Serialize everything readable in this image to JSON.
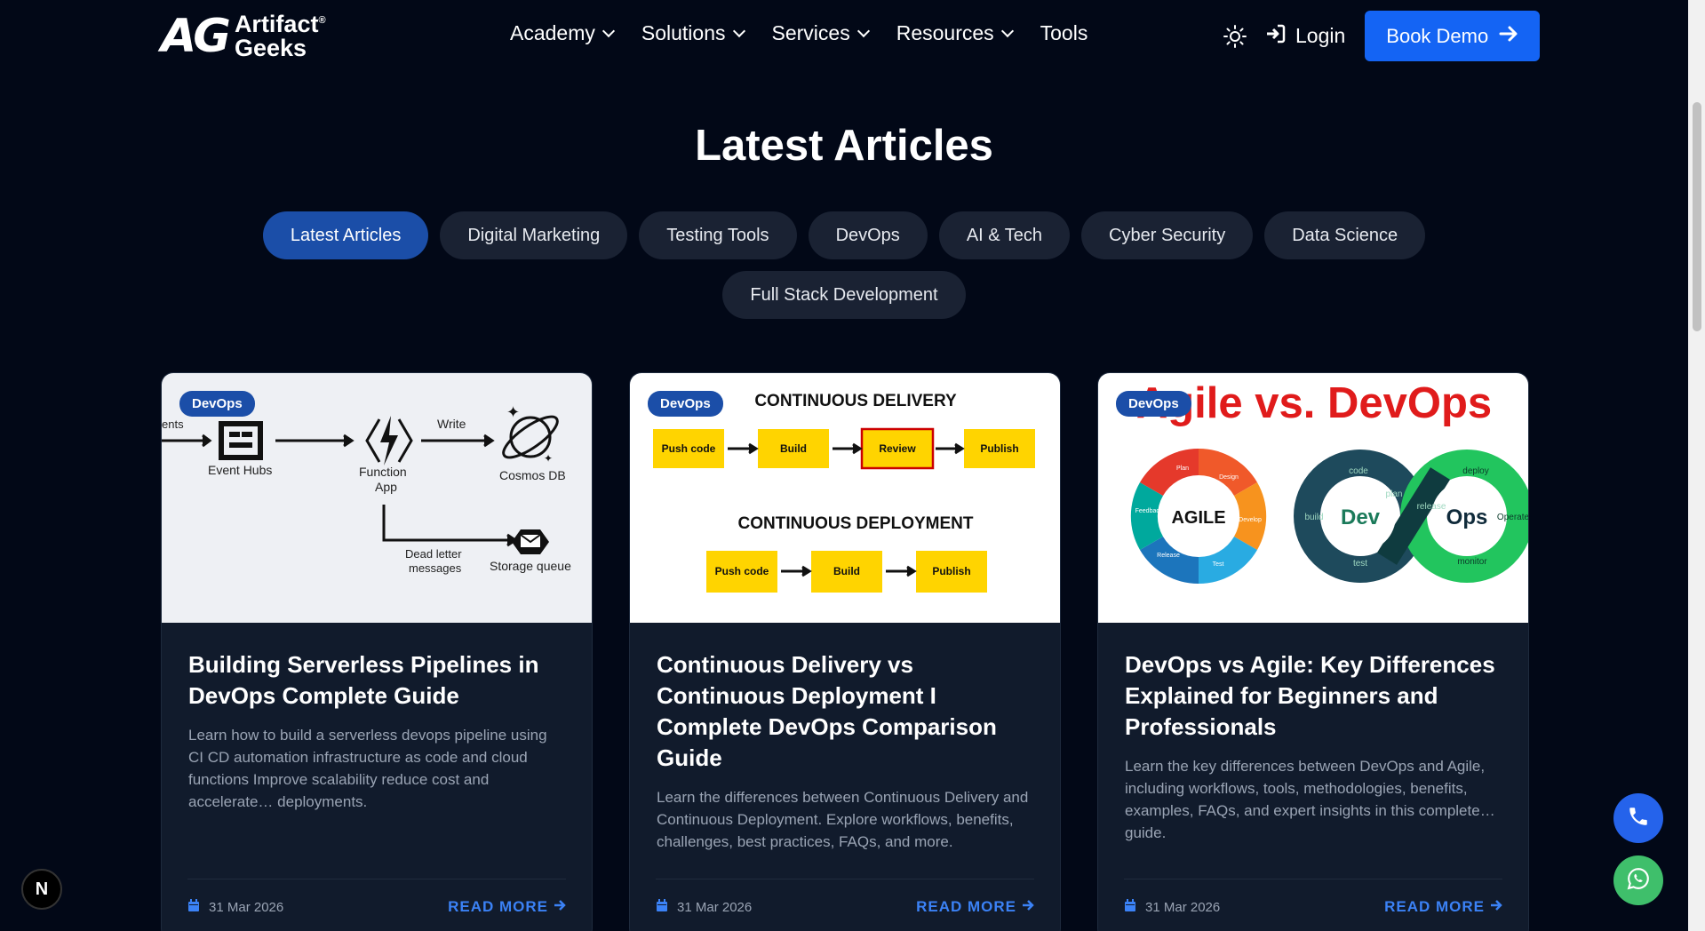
{
  "header": {
    "logo_mark": "AG",
    "logo_line1": "Artifact",
    "logo_line2": "Geeks",
    "logo_reg": "®",
    "nav": [
      {
        "label": "Academy",
        "dropdown": true
      },
      {
        "label": "Solutions",
        "dropdown": true
      },
      {
        "label": "Services",
        "dropdown": true
      },
      {
        "label": "Resources",
        "dropdown": true
      },
      {
        "label": "Tools",
        "dropdown": false
      }
    ],
    "login_label": "Login",
    "book_demo_label": "Book Demo"
  },
  "section": {
    "title": "Latest Articles",
    "tabs_row1": [
      "Latest Articles",
      "Digital Marketing",
      "Testing Tools",
      "DevOps",
      "AI & Tech",
      "Cyber Security",
      "Data Science"
    ],
    "tabs_row2": [
      "Full Stack Development"
    ],
    "active_tab": "Latest Articles"
  },
  "cards": [
    {
      "badge": "DevOps",
      "title": "Building Serverless Pipelines in DevOps Complete Guide",
      "description": "Learn how to build a serverless devops pipeline using CI CD automation infrastructure as code and cloud functions Improve scalability reduce cost and accelerate… deployments.",
      "date": "31 Mar 2026",
      "read_more": "READ MORE",
      "image_labels": {
        "events": "ents",
        "event_hubs": "Event Hubs",
        "write": "Write",
        "function_app_1": "Function",
        "function_app_2": "App",
        "cosmos": "Cosmos DB",
        "dead1": "Dead letter",
        "dead2": "messages",
        "storage": "Storage queue"
      }
    },
    {
      "badge": "DevOps",
      "title": "Continuous Delivery vs Continuous Deployment I Complete DevOps Comparison Guide",
      "description": "Learn the differences between Continuous Delivery and Continuous Deployment. Explore workflows, benefits, challenges, best practices, FAQs, and more.",
      "date": "31 Mar 2026",
      "read_more": "READ MORE",
      "image_labels": {
        "cd_title": "CONTINUOUS DELIVERY",
        "cdp_title": "CONTINUOUS DEPLOYMENT",
        "push": "Push code",
        "build": "Build",
        "review": "Review",
        "publish": "Publish"
      }
    },
    {
      "badge": "DevOps",
      "title": "DevOps vs Agile: Key Differences Explained for Beginners and Professionals",
      "description": "Learn the key differences between DevOps and Agile, including workflows, tools, methodologies, benefits, examples, FAQs, and expert insights in this complete… guide.",
      "date": "31 Mar 2026",
      "read_more": "READ MORE",
      "image_labels": {
        "headline": "Agile vs. DevOps",
        "agile": "AGILE",
        "dev": "Dev",
        "ops": "Ops",
        "plan": "Plan",
        "design": "Design",
        "develop": "Develop",
        "test": "Test",
        "release": "Release",
        "feedback": "Feedback",
        "code": "code",
        "build": "build",
        "deploy": "deploy",
        "operate": "Operate",
        "monitor": "monitor",
        "test2": "test",
        "plan2": "plan",
        "release2": "release"
      }
    }
  ],
  "widgets": {
    "next_badge": "N"
  },
  "colors": {
    "background": "#020817",
    "accent": "#1464f4",
    "active_tab": "#1b4ea8",
    "read_more": "#3b82f6"
  }
}
